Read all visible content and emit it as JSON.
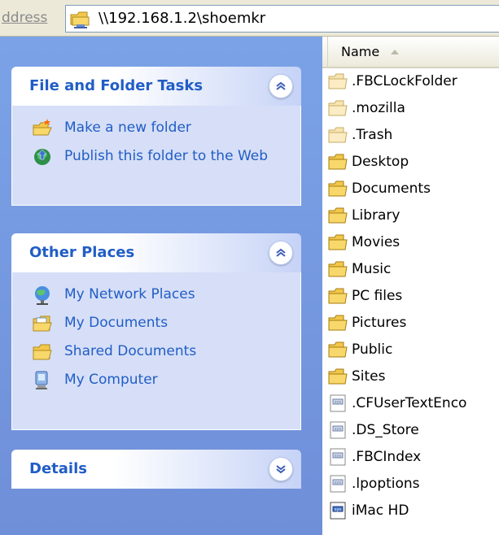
{
  "address": {
    "label": "ddress",
    "path": "\\\\192.168.1.2\\shoemkr"
  },
  "taskpane": {
    "file_tasks": {
      "title": "File and Folder Tasks",
      "items": [
        {
          "label": "Make a new folder",
          "icon": "new-folder-icon"
        },
        {
          "label": "Publish this folder to the Web",
          "icon": "publish-web-icon"
        }
      ]
    },
    "other_places": {
      "title": "Other Places",
      "items": [
        {
          "label": "My Network Places",
          "icon": "network-places-icon"
        },
        {
          "label": "My Documents",
          "icon": "my-documents-icon"
        },
        {
          "label": "Shared Documents",
          "icon": "shared-documents-icon"
        },
        {
          "label": "My Computer",
          "icon": "my-computer-icon"
        }
      ]
    },
    "details": {
      "title": "Details"
    }
  },
  "filelist": {
    "column_name": "Name",
    "files": [
      {
        "name": ".FBCLockFolder",
        "type": "hidden-folder"
      },
      {
        "name": ".mozilla",
        "type": "hidden-folder"
      },
      {
        "name": ".Trash",
        "type": "hidden-folder"
      },
      {
        "name": "Desktop",
        "type": "folder"
      },
      {
        "name": "Documents",
        "type": "folder"
      },
      {
        "name": "Library",
        "type": "folder"
      },
      {
        "name": "Movies",
        "type": "folder"
      },
      {
        "name": "Music",
        "type": "folder"
      },
      {
        "name": "PC files",
        "type": "folder"
      },
      {
        "name": "Pictures",
        "type": "folder"
      },
      {
        "name": "Public",
        "type": "folder"
      },
      {
        "name": "Sites",
        "type": "folder"
      },
      {
        "name": ".CFUserTextEnco",
        "type": "file"
      },
      {
        "name": ".DS_Store",
        "type": "file"
      },
      {
        "name": ".FBCIndex",
        "type": "file"
      },
      {
        "name": ".lpoptions",
        "type": "file"
      },
      {
        "name": "iMac HD",
        "type": "drive-file"
      }
    ]
  },
  "colors": {
    "pane_bg": "#7ba2e7",
    "panel_body": "#d6dff7",
    "link_blue": "#215dc6"
  }
}
